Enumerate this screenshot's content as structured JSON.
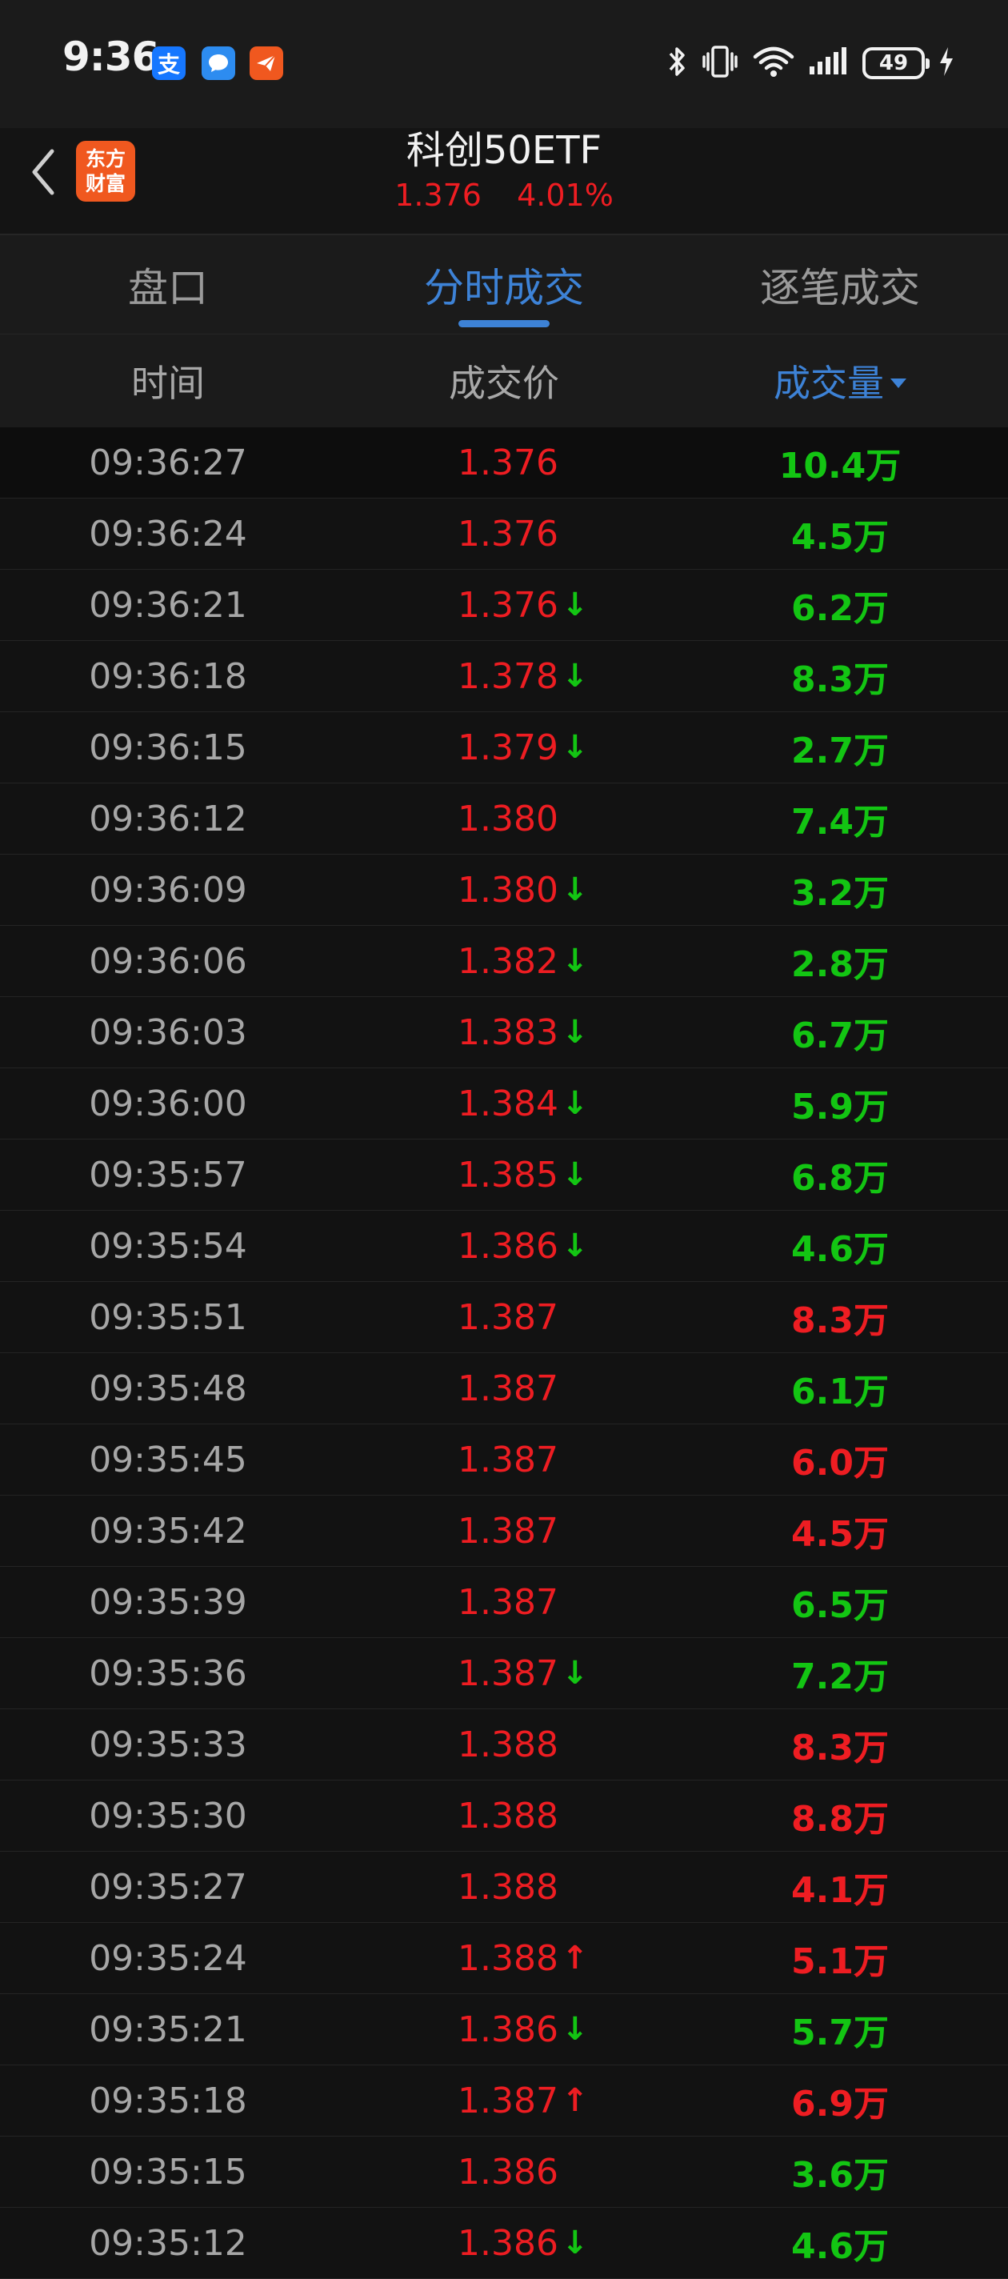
{
  "status_bar": {
    "time": "9:36",
    "app_icons": [
      {
        "name": "alipay-icon",
        "glyph": "支",
        "color": "#1677ff"
      },
      {
        "name": "chat-bubble-icon",
        "glyph": "●",
        "color": "#2d8cf0"
      },
      {
        "name": "paper-plane-icon",
        "glyph": "➤",
        "color": "#f0581f"
      }
    ],
    "battery": "49"
  },
  "header": {
    "title": "科创50ETF",
    "price": "1.376",
    "change_pct": "4.01%",
    "logo_line1": "东方",
    "logo_line2": "财富"
  },
  "tabs": [
    {
      "label": "盘口",
      "active": false
    },
    {
      "label": "分时成交",
      "active": true
    },
    {
      "label": "逐笔成交",
      "active": false
    }
  ],
  "columns": {
    "time": "时间",
    "price": "成交价",
    "volume": "成交量"
  },
  "trades": [
    {
      "time": "09:36:27",
      "price": "1.376",
      "dir": "",
      "volume": "10.4万",
      "vol_side": "down"
    },
    {
      "time": "09:36:24",
      "price": "1.376",
      "dir": "",
      "volume": "4.5万",
      "vol_side": "down"
    },
    {
      "time": "09:36:21",
      "price": "1.376",
      "dir": "↓",
      "volume": "6.2万",
      "vol_side": "down"
    },
    {
      "time": "09:36:18",
      "price": "1.378",
      "dir": "↓",
      "volume": "8.3万",
      "vol_side": "down"
    },
    {
      "time": "09:36:15",
      "price": "1.379",
      "dir": "↓",
      "volume": "2.7万",
      "vol_side": "down"
    },
    {
      "time": "09:36:12",
      "price": "1.380",
      "dir": "",
      "volume": "7.4万",
      "vol_side": "down"
    },
    {
      "time": "09:36:09",
      "price": "1.380",
      "dir": "↓",
      "volume": "3.2万",
      "vol_side": "down"
    },
    {
      "time": "09:36:06",
      "price": "1.382",
      "dir": "↓",
      "volume": "2.8万",
      "vol_side": "down"
    },
    {
      "time": "09:36:03",
      "price": "1.383",
      "dir": "↓",
      "volume": "6.7万",
      "vol_side": "down"
    },
    {
      "time": "09:36:00",
      "price": "1.384",
      "dir": "↓",
      "volume": "5.9万",
      "vol_side": "down"
    },
    {
      "time": "09:35:57",
      "price": "1.385",
      "dir": "↓",
      "volume": "6.8万",
      "vol_side": "down"
    },
    {
      "time": "09:35:54",
      "price": "1.386",
      "dir": "↓",
      "volume": "4.6万",
      "vol_side": "down"
    },
    {
      "time": "09:35:51",
      "price": "1.387",
      "dir": "",
      "volume": "8.3万",
      "vol_side": "up"
    },
    {
      "time": "09:35:48",
      "price": "1.387",
      "dir": "",
      "volume": "6.1万",
      "vol_side": "down"
    },
    {
      "time": "09:35:45",
      "price": "1.387",
      "dir": "",
      "volume": "6.0万",
      "vol_side": "up"
    },
    {
      "time": "09:35:42",
      "price": "1.387",
      "dir": "",
      "volume": "4.5万",
      "vol_side": "up"
    },
    {
      "time": "09:35:39",
      "price": "1.387",
      "dir": "",
      "volume": "6.5万",
      "vol_side": "down"
    },
    {
      "time": "09:35:36",
      "price": "1.387",
      "dir": "↓",
      "volume": "7.2万",
      "vol_side": "down"
    },
    {
      "time": "09:35:33",
      "price": "1.388",
      "dir": "",
      "volume": "8.3万",
      "vol_side": "up"
    },
    {
      "time": "09:35:30",
      "price": "1.388",
      "dir": "",
      "volume": "8.8万",
      "vol_side": "up"
    },
    {
      "time": "09:35:27",
      "price": "1.388",
      "dir": "",
      "volume": "4.1万",
      "vol_side": "up"
    },
    {
      "time": "09:35:24",
      "price": "1.388",
      "dir": "↑",
      "volume": "5.1万",
      "vol_side": "up"
    },
    {
      "time": "09:35:21",
      "price": "1.386",
      "dir": "↓",
      "volume": "5.7万",
      "vol_side": "down"
    },
    {
      "time": "09:35:18",
      "price": "1.387",
      "dir": "↑",
      "volume": "6.9万",
      "vol_side": "up"
    },
    {
      "time": "09:35:15",
      "price": "1.386",
      "dir": "",
      "volume": "3.6万",
      "vol_side": "down"
    },
    {
      "time": "09:35:12",
      "price": "1.386",
      "dir": "↓",
      "volume": "4.6万",
      "vol_side": "down"
    }
  ],
  "colors": {
    "up": "#ee1d22",
    "down": "#13c513",
    "accent": "#3d82d6",
    "brand": "#f0581f"
  }
}
